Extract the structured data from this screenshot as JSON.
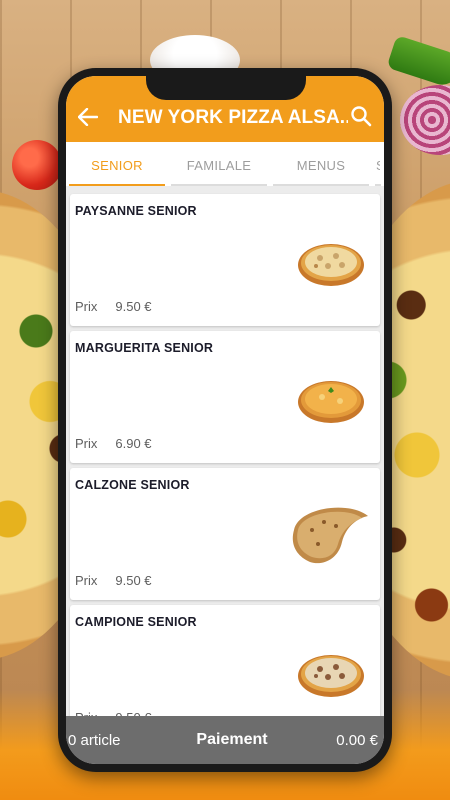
{
  "app": {
    "title": "NEW YORK PIZZA ALSA..."
  },
  "tabs": [
    {
      "label": "SENIOR",
      "active": true
    },
    {
      "label": "FAMILALE",
      "active": false
    },
    {
      "label": "MENUS",
      "active": false
    },
    {
      "label": "S",
      "active": false
    }
  ],
  "price_label": "Prix",
  "products": [
    {
      "name": "PAYSANNE SENIOR",
      "price": "9.50 €",
      "image": "pizza-paysanne"
    },
    {
      "name": "MARGUERITA SENIOR",
      "price": "6.90 €",
      "image": "pizza-marguerita"
    },
    {
      "name": "CALZONE SENIOR",
      "price": "9.50 €",
      "image": "calzone"
    },
    {
      "name": "CAMPIONE SENIOR",
      "price": "9.50 €",
      "image": "pizza-campione"
    }
  ],
  "footer": {
    "count": "0 article",
    "pay_label": "Paiement",
    "total": "0.00 €"
  },
  "colors": {
    "accent": "#f29d1c",
    "footer": "#6d6d6d"
  }
}
